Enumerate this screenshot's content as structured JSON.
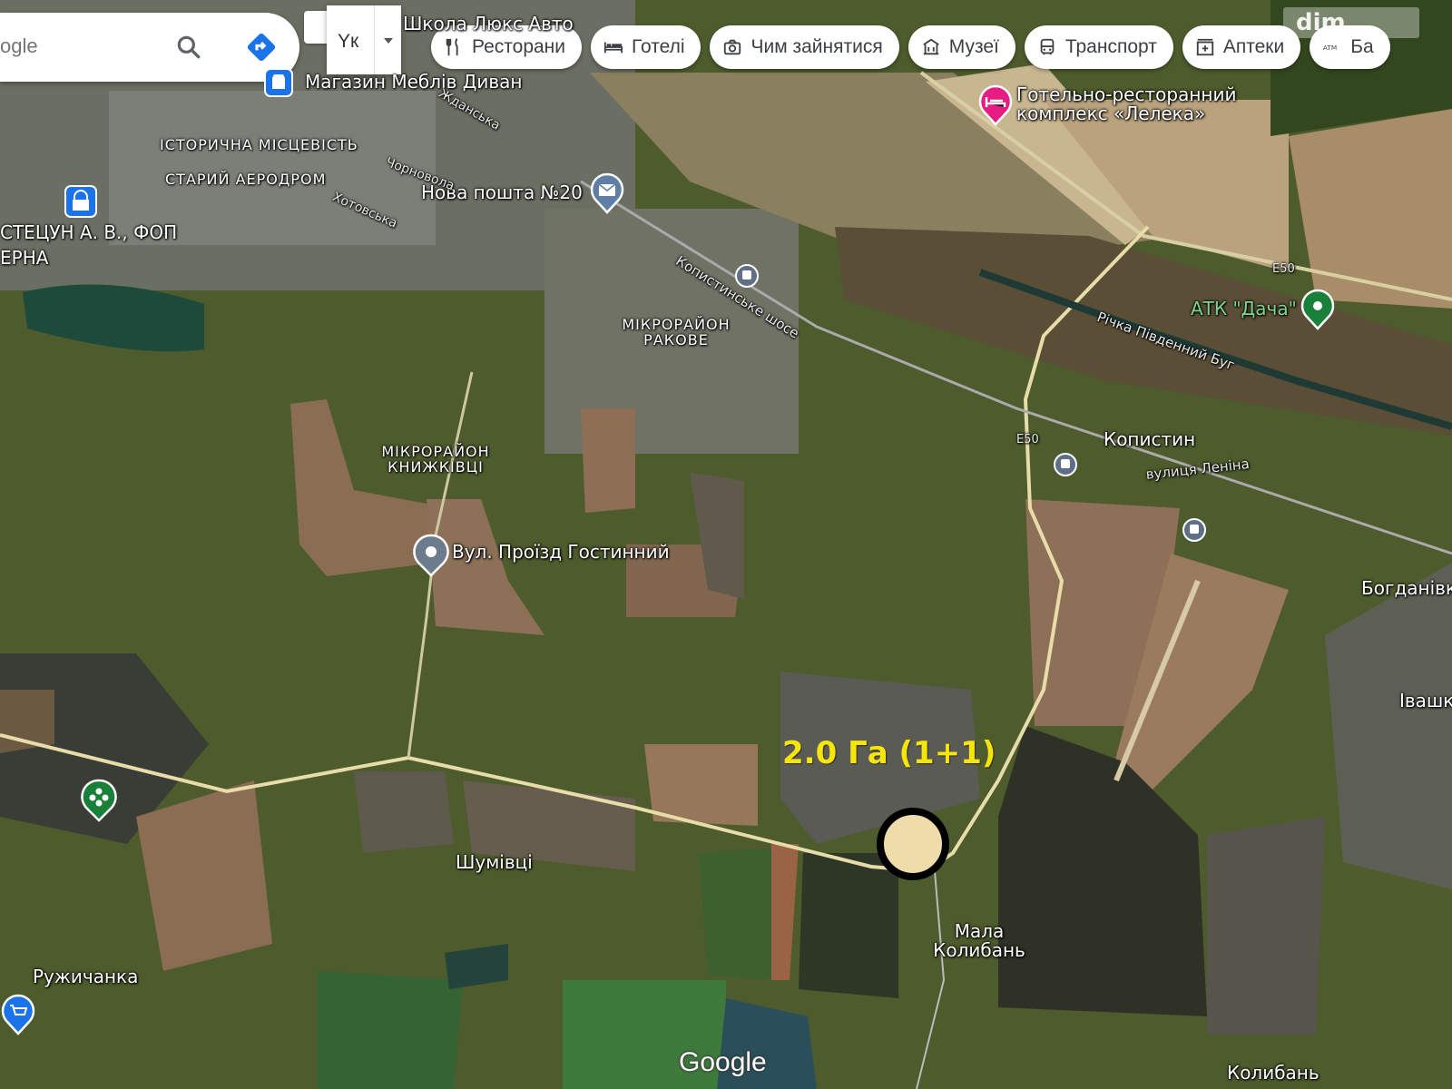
{
  "search": {
    "value": "ogle"
  },
  "language": {
    "code": "Yк"
  },
  "chips": [
    {
      "label": "Ресторани",
      "icon": "fork-knife-icon"
    },
    {
      "label": "Готелі",
      "icon": "bed-icon"
    },
    {
      "label": "Чим зайнятися",
      "icon": "camera-icon"
    },
    {
      "label": "Музеї",
      "icon": "museum-icon"
    },
    {
      "label": "Транспорт",
      "icon": "bus-icon"
    },
    {
      "label": "Аптеки",
      "icon": "pharmacy-icon"
    },
    {
      "label": "Ба",
      "icon": "atm-icon"
    }
  ],
  "corner_logo": {
    "text": "dim"
  },
  "places": {
    "shkola": "Школа Люкс Авто",
    "mebli": "Магазин Меблів Диван",
    "istorychna": "ІСТОРИЧНА МІСЦЕВІСТЬ",
    "aerodrom": "СТАРИЙ АЕРОДРОМ",
    "stetsun": "СТЕЦУН А. В., ФОП",
    "cherna": "ЕРНА",
    "nova_poshta": "Нова пошта №20",
    "hotel": "Готельно-ресторанний комплекс «Лелека»",
    "atk": "АТК \"Дача\"",
    "rakove": "МІКРОРАЙОН РАКОВЕ",
    "knyzhkivtsi": "МІКРОРАЙОН КНИЖКІВЦІ",
    "kopystyn": "Копистин",
    "proizd": "Вул. Проїзд Гостинний",
    "bohdanivka": "Богданівк",
    "ivashky": "Івашк",
    "shumivtsi": "Шумівці",
    "ruzhychanka": "Ружичанка",
    "mala_kolyban": "Мала Колибань",
    "kolyban": "Колибань"
  },
  "roads": {
    "kopystynske": "Копистинське шосе",
    "river": "Річка Південний Буг",
    "lenina": "вулиця Леніна",
    "e50_a": "E50",
    "e50_b": "E50",
    "chornovola": "Чорновола",
    "khotovska": "Хотовська",
    "zhdanska": "Жданська"
  },
  "parcel": {
    "label": "2.0 Га (1+1)"
  },
  "attribution": {
    "google": "Google"
  }
}
